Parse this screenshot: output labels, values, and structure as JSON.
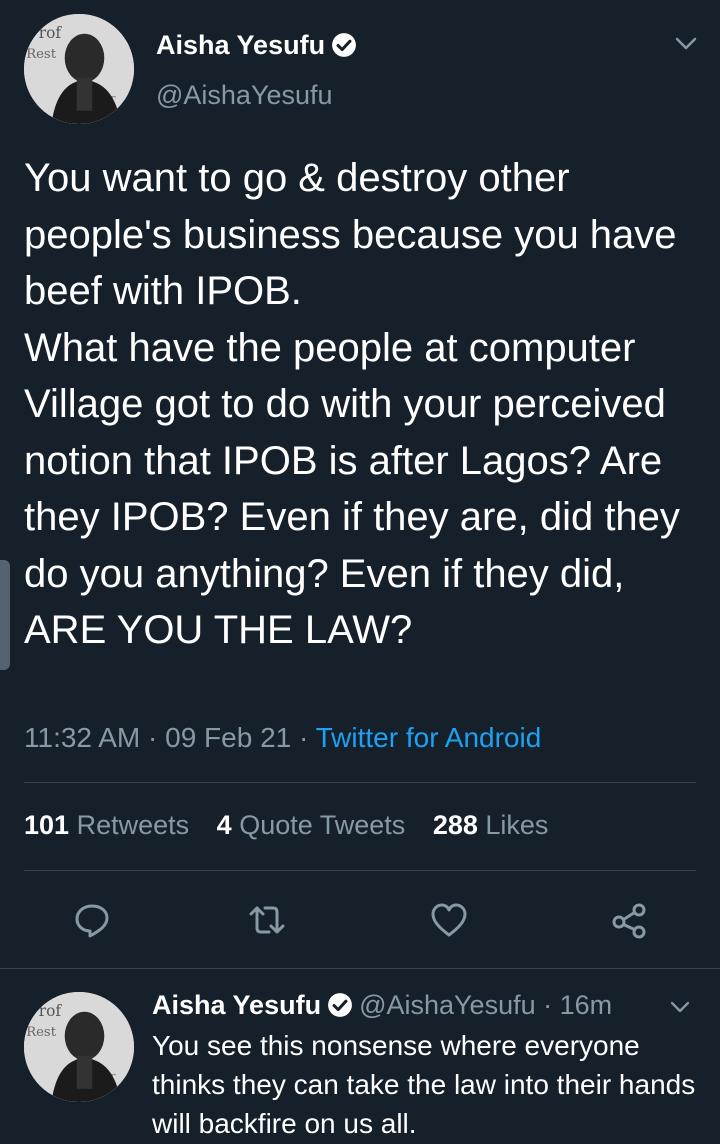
{
  "tweet": {
    "author_name": "Aisha Yesufu",
    "author_handle": "@AishaYesufu",
    "text": "You want to go & destroy other people's business because you have beef with IPOB.\nWhat have the people at computer Village got to do with your perceived notion that IPOB is after Lagos? Are they IPOB? Even if they are, did they do you anything? Even if they did, ARE YOU THE LAW?",
    "time": "11:32 AM",
    "date": "09 Feb 21",
    "source": "Twitter for Android",
    "separator": " · "
  },
  "stats": {
    "retweets_count": "101",
    "retweets_label": "Retweets",
    "quotes_count": "4",
    "quotes_label": "Quote Tweets",
    "likes_count": "288",
    "likes_label": "Likes"
  },
  "actions": [
    "reply-icon",
    "retweet-icon",
    "like-icon",
    "share-icon"
  ],
  "reply": {
    "author_name": "Aisha Yesufu",
    "author_handle": "@AishaYesufu",
    "time_ago": "16m",
    "separator": " · ",
    "text": "You see this nonsense where everyone thinks they can take the law into their hands will backfire on us all."
  },
  "colors": {
    "background": "#15202b",
    "secondary_text": "#8899a6",
    "accent": "#1da1f2",
    "divider": "#38444d"
  }
}
